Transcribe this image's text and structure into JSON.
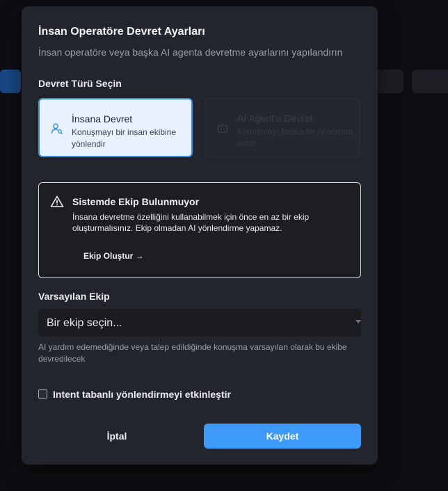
{
  "modal": {
    "title": "İnsan Operatöre Devret Ayarları",
    "subtitle": "İnsan operatöre veya başka AI agenta devretme ayarlarını yapılandırın"
  },
  "handoff_type": {
    "label": "Devret Türü Seçin",
    "options": [
      {
        "title": "İnsana Devret",
        "description": "Konuşmayı bir insan ekibine yönlendir",
        "selected": true,
        "icon": "user-search-icon"
      },
      {
        "title": "AI Agent'a Devret",
        "description": "Konuşmayı başka bir AI agenta aktar",
        "selected": false,
        "disabled": true,
        "icon": "bot-icon"
      }
    ]
  },
  "alert": {
    "title": "Sistemde Ekip Bulunmuyor",
    "text": "İnsana devretme özelliğini kullanabilmek için önce en az bir ekip oluşturmalısınız. Ekip olmadan AI yönlendirme yapamaz.",
    "link_label": "Ekip Oluştur →",
    "icon": "warning-triangle-icon"
  },
  "default_team": {
    "label": "Varsayılan Ekip",
    "placeholder": "Bir ekip seçin...",
    "helper": "AI yardım edemediğinde veya talep edildiğinde konuşma varsayılan olarak bu ekibe devredilecek"
  },
  "intent_routing": {
    "label": "Intent tabanlı yönlendirmeyi etkinleştir",
    "checked": false
  },
  "actions": {
    "cancel_label": "İptal",
    "save_label": "Kaydet"
  },
  "colors": {
    "accent": "#3d9bf7",
    "selected_card_bg": "#e7f2fd",
    "selected_card_border": "#3b8ce8",
    "modal_bg": "#22252b"
  }
}
